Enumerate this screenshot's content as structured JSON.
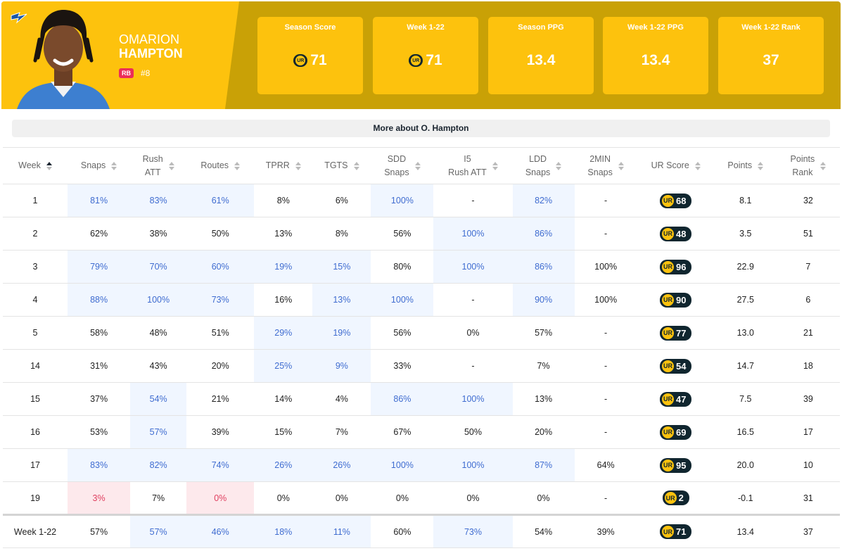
{
  "player": {
    "first_name": "OMARION",
    "last_name": "HAMPTON",
    "position": "RB",
    "jersey": "#8",
    "team_logo_icon": "lightning-bolt-icon"
  },
  "colors": {
    "header_gold": "#fdc20d",
    "header_dark_gold": "#c9a106",
    "highlight_blue": "#3f6cd0",
    "low_red": "#e04060",
    "ur_dark": "#10262f"
  },
  "stat_cards": [
    {
      "label": "Season Score",
      "value": "71",
      "ur_icon": true
    },
    {
      "label": "Week 1-22",
      "value": "71",
      "ur_icon": true
    },
    {
      "label": "Season PPG",
      "value": "13.4",
      "ur_icon": false
    },
    {
      "label": "Week 1-22 PPG",
      "value": "13.4",
      "ur_icon": false
    },
    {
      "label": "Week 1-22 Rank",
      "value": "37",
      "ur_icon": false
    }
  ],
  "more_link": "More about O. Hampton",
  "table": {
    "columns": [
      {
        "line1": "Week",
        "line2": ""
      },
      {
        "line1": "Snaps",
        "line2": ""
      },
      {
        "line1": "Rush",
        "line2": "ATT"
      },
      {
        "line1": "Routes",
        "line2": ""
      },
      {
        "line1": "TPRR",
        "line2": ""
      },
      {
        "line1": "TGTS",
        "line2": ""
      },
      {
        "line1": "SDD",
        "line2": "Snaps"
      },
      {
        "line1": "I5",
        "line2": "Rush ATT"
      },
      {
        "line1": "LDD",
        "line2": "Snaps"
      },
      {
        "line1": "2MIN",
        "line2": "Snaps"
      },
      {
        "line1": "UR Score",
        "line2": ""
      },
      {
        "line1": "Points",
        "line2": ""
      },
      {
        "line1": "Points",
        "line2": "Rank"
      }
    ],
    "ur_icon_label": "UR",
    "rows": [
      {
        "week": "1",
        "snaps": "81%",
        "rush": "83%",
        "routes": "61%",
        "tprr": "8%",
        "tgts": "6%",
        "sdd": "100%",
        "i5": "-",
        "ldd": "82%",
        "min2": "-",
        "ur": "68",
        "points": "8.1",
        "rank": "32"
      },
      {
        "week": "2",
        "snaps": "62%",
        "rush": "38%",
        "routes": "50%",
        "tprr": "13%",
        "tgts": "8%",
        "sdd": "56%",
        "i5": "100%",
        "ldd": "86%",
        "min2": "-",
        "ur": "48",
        "points": "3.5",
        "rank": "51"
      },
      {
        "week": "3",
        "snaps": "79%",
        "rush": "70%",
        "routes": "60%",
        "tprr": "19%",
        "tgts": "15%",
        "sdd": "80%",
        "i5": "100%",
        "ldd": "86%",
        "min2": "100%",
        "ur": "96",
        "points": "22.9",
        "rank": "7"
      },
      {
        "week": "4",
        "snaps": "88%",
        "rush": "100%",
        "routes": "73%",
        "tprr": "16%",
        "tgts": "13%",
        "sdd": "100%",
        "i5": "-",
        "ldd": "90%",
        "min2": "100%",
        "ur": "90",
        "points": "27.5",
        "rank": "6"
      },
      {
        "week": "5",
        "snaps": "58%",
        "rush": "48%",
        "routes": "51%",
        "tprr": "29%",
        "tgts": "19%",
        "sdd": "56%",
        "i5": "0%",
        "ldd": "57%",
        "min2": "-",
        "ur": "77",
        "points": "13.0",
        "rank": "21"
      },
      {
        "week": "14",
        "snaps": "31%",
        "rush": "43%",
        "routes": "20%",
        "tprr": "25%",
        "tgts": "9%",
        "sdd": "33%",
        "i5": "-",
        "ldd": "7%",
        "min2": "-",
        "ur": "54",
        "points": "14.7",
        "rank": "18"
      },
      {
        "week": "15",
        "snaps": "37%",
        "rush": "54%",
        "routes": "21%",
        "tprr": "14%",
        "tgts": "4%",
        "sdd": "86%",
        "i5": "100%",
        "ldd": "13%",
        "min2": "-",
        "ur": "47",
        "points": "7.5",
        "rank": "39"
      },
      {
        "week": "16",
        "snaps": "53%",
        "rush": "57%",
        "routes": "39%",
        "tprr": "15%",
        "tgts": "7%",
        "sdd": "67%",
        "i5": "50%",
        "ldd": "20%",
        "min2": "-",
        "ur": "69",
        "points": "16.5",
        "rank": "17"
      },
      {
        "week": "17",
        "snaps": "83%",
        "rush": "82%",
        "routes": "74%",
        "tprr": "26%",
        "tgts": "26%",
        "sdd": "100%",
        "i5": "100%",
        "ldd": "87%",
        "min2": "64%",
        "ur": "95",
        "points": "20.0",
        "rank": "10"
      },
      {
        "week": "19",
        "snaps": "3%",
        "rush": "7%",
        "routes": "0%",
        "tprr": "0%",
        "tgts": "0%",
        "sdd": "0%",
        "i5": "0%",
        "ldd": "0%",
        "min2": "-",
        "ur": "2",
        "points": "-0.1",
        "rank": "31"
      }
    ],
    "total": {
      "week": "Week 1-22",
      "snaps": "57%",
      "rush": "57%",
      "routes": "46%",
      "tprr": "18%",
      "tgts": "11%",
      "sdd": "60%",
      "i5": "73%",
      "ldd": "54%",
      "min2": "39%",
      "ur": "71",
      "points": "13.4",
      "rank": "37"
    }
  },
  "cell_styles": {
    "rows": [
      {
        "snaps": "hl",
        "rush": "hl",
        "routes": "hl",
        "sdd": "hl",
        "ldd": "hl"
      },
      {
        "i5": "hl",
        "ldd": "hl"
      },
      {
        "snaps": "hl",
        "rush": "hl",
        "routes": "hl",
        "tprr": "hl",
        "tgts": "hl",
        "i5": "hl",
        "ldd": "hl"
      },
      {
        "snaps": "hl",
        "rush": "hl",
        "routes": "hl",
        "tgts": "hl",
        "sdd": "hl",
        "ldd": "hl"
      },
      {
        "tprr": "hl",
        "tgts": "hl"
      },
      {
        "tprr": "hl",
        "tgts": "hl"
      },
      {
        "rush": "hl",
        "sdd": "hl",
        "i5": "hl"
      },
      {
        "rush": "hl"
      },
      {
        "snaps": "hl",
        "rush": "hl",
        "routes": "hl",
        "tprr": "hl",
        "tgts": "hl",
        "sdd": "hl",
        "i5": "hl",
        "ldd": "hl"
      },
      {
        "snaps": "lo",
        "routes": "lo"
      }
    ],
    "total": {
      "rush": "hl",
      "routes": "hl",
      "tprr": "hl",
      "tgts": "hl",
      "i5": "hl"
    }
  }
}
